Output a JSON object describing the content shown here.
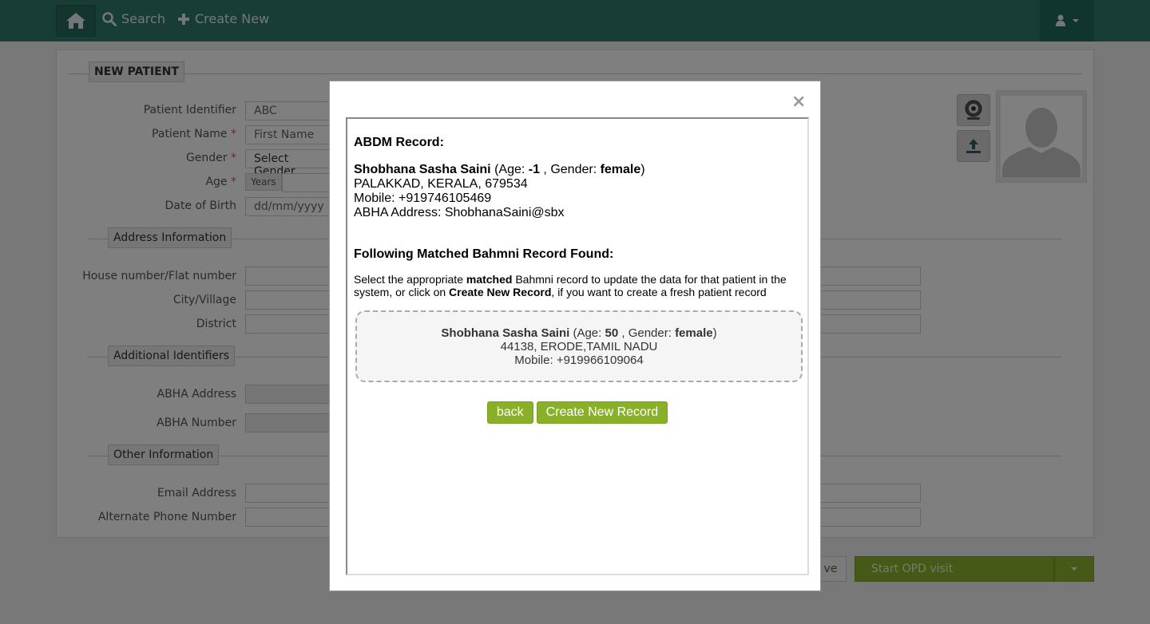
{
  "topbar": {
    "search_label": "Search",
    "create_new_label": "Create New"
  },
  "form": {
    "section_title": "NEW PATIENT",
    "patient_identifier": {
      "label": "Patient Identifier",
      "value": "ABC"
    },
    "patient_name": {
      "label": "Patient Name",
      "placeholder": "First Name"
    },
    "gender": {
      "label": "Gender",
      "value": "Select Gender"
    },
    "age": {
      "label": "Age",
      "unit": "Years"
    },
    "dob": {
      "label": "Date of Birth",
      "placeholder": "dd/mm/yyyy"
    },
    "required_mark": "*",
    "address_section": "Address Information",
    "house_label": "House number/Flat number",
    "city_label": "City/Village",
    "district_label": "District",
    "additional_section": "Additional Identifiers",
    "abha_address_label": "ABHA Address",
    "abha_number_label": "ABHA Number",
    "other_section": "Other Information",
    "email_label": "Email Address",
    "alt_phone_label": "Alternate Phone Number"
  },
  "footer": {
    "save_label": "ve",
    "start_opd_label": "Start OPD visit"
  },
  "modal": {
    "close_label": "×",
    "abdm_heading": "ABDM Record:",
    "abdm_record": {
      "name": "Shobhana Sasha Saini",
      "age_prefix": "(Age: ",
      "age": "-1",
      "gender_prefix": " , Gender: ",
      "gender": "female",
      "close_paren": ")",
      "address": "PALAKKAD, KERALA, 679534",
      "mobile": "Mobile: +919746105469",
      "abha_address": "ABHA Address: ShobhanaSaini@sbx"
    },
    "matched_heading": "Following Matched Bahmni Record Found:",
    "instruction": {
      "part1": "Select the appropriate ",
      "matched": "matched",
      "part2": " Bahmni record to update the data for that patient in the system, or click on ",
      "create_new": "Create New Record",
      "part3": ", if you want to create a fresh patient record"
    },
    "match": {
      "name": "Shobhana Sasha Saini",
      "age_prefix": "(Age: ",
      "age": "50",
      "gender_prefix": " , Gender: ",
      "gender": "female",
      "close_paren": ")",
      "address": "44138, ERODE,TAMIL NADU",
      "mobile": "Mobile: +919966109064"
    },
    "back_label": "back",
    "create_new_label": "Create New Record"
  },
  "colors": {
    "topbar": "#2f7b6c",
    "action_green": "#88b128"
  }
}
